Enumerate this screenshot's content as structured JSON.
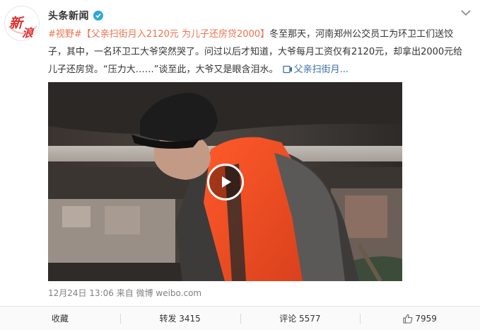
{
  "post": {
    "author": "头条新闻",
    "avatar_text": [
      "新",
      "浪"
    ],
    "topic": "#视野#",
    "title_pre": "【父亲扫街月入",
    "title_amount": "2120元",
    "title_post": " 为儿子还房贷2000】",
    "body": "冬至那天，河南郑州公交员工为环卫工们送饺子，其中，一名环卫工大爷突然哭了。问过以后才知道，大爷每月工资仅有2120元，却拿出2000元给儿子还房贷。“压力大……”谈至此，大爷又是眼含泪水。",
    "video_link": "父亲扫街月...",
    "time": "12月24日 13:06",
    "source_prefix": " 来自 ",
    "source": "微博 weibo.com"
  },
  "actions": {
    "favorite": "收藏",
    "repost": "转发 3415",
    "comment": "评论 5577",
    "like": "7959"
  },
  "colors": {
    "accent": "#eb7350",
    "link": "#3a6da5",
    "verified": "#2ea7e0",
    "brand_red": "#e02d2d"
  }
}
